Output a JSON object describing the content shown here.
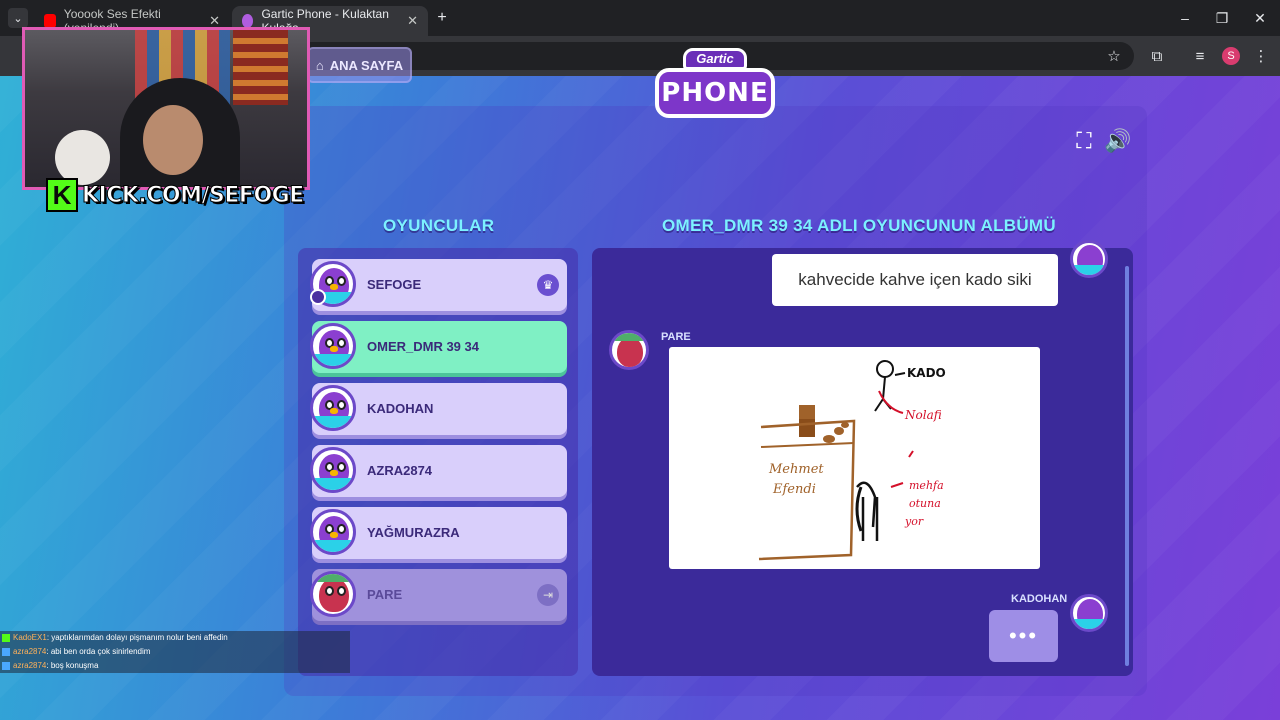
{
  "browser": {
    "tabs": [
      {
        "title": "Yooook Ses Efekti (yenilendi) -",
        "icon": "youtube-icon",
        "active": false
      },
      {
        "title": "Gartic Phone - Kulaktan Kulağa",
        "icon": "gartic-phone-icon",
        "active": true
      }
    ],
    "new_tab": "+",
    "window_controls": {
      "minimize": "–",
      "restore": "❐",
      "close": "✕"
    },
    "profile_initial": "S"
  },
  "game": {
    "home_button": "ANA SAYFA",
    "logo": {
      "top": "Gartic",
      "main": "PHONE"
    },
    "players_title": "OYUNCULAR",
    "album_title": "OMER_DMR 39 34 ADLI OYUNCUNUN ALBÜMÜ",
    "players": [
      {
        "name": "SEFOGE",
        "badge": "crown-icon",
        "state": "host"
      },
      {
        "name": "OMER_DMR 39 34",
        "state": "current"
      },
      {
        "name": "KADOHAN",
        "state": "normal"
      },
      {
        "name": "AZRA2874",
        "state": "normal"
      },
      {
        "name": "YAĞMURAZRA",
        "state": "normal"
      },
      {
        "name": "PARE",
        "badge": "exit-icon",
        "state": "left"
      }
    ],
    "album": {
      "first_text": "kahvecide kahve içen kado siki",
      "drawing_author": "PARE",
      "drawing_labels": [
        "KADO",
        "Nolafi",
        "Mehmet",
        "Efendi",
        "mehfa",
        "otuna",
        "yor"
      ],
      "next_author": "KADOHAN",
      "waiting": "•••"
    }
  },
  "overlay": {
    "kick_logo": "K",
    "kick_text": "KICK.COM/SEFOGE",
    "chat": [
      {
        "user": "KadoEX1",
        "message": "yaptıklarımdan dolayı pişmanım nolur beni affedin"
      },
      {
        "user": "azra2874",
        "message": "abi ben orda çok sinirlendim"
      },
      {
        "user": "azra2874",
        "message": "boş konuşma"
      }
    ]
  },
  "colors": {
    "accent_teal": "#7cf1ff",
    "current_player": "#7ff0c4",
    "kick_green": "#53fc18"
  }
}
